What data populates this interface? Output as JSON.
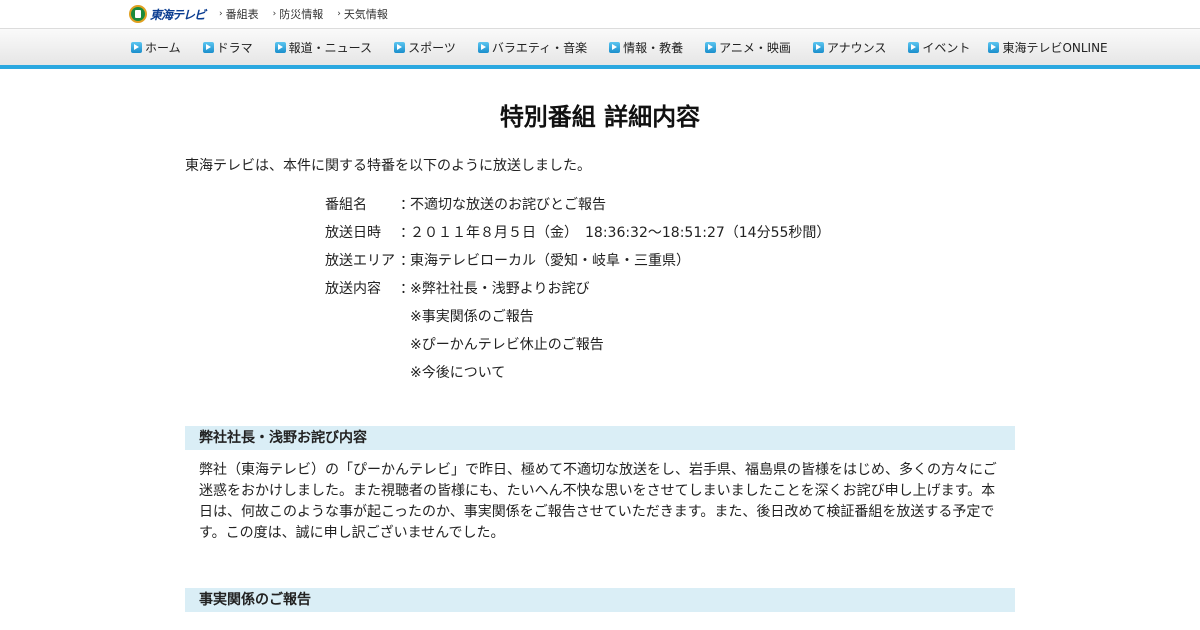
{
  "header": {
    "logo_text": "東海テレビ",
    "util_links": [
      "番組表",
      "防災情報",
      "天気情報"
    ]
  },
  "nav": {
    "items": [
      "ホーム",
      "ドラマ",
      "報道・ニュース",
      "スポーツ",
      "バラエティ・音楽",
      "情報・教養",
      "アニメ・映画",
      "アナウンス",
      "イベント",
      "東海テレビONLINE"
    ]
  },
  "main": {
    "title": "特別番組 詳細内容",
    "intro": "東海テレビは、本件に関する特番を以下のように放送しました。",
    "details": [
      {
        "label": "番組名",
        "sep": "：",
        "value": "不適切な放送のお詫びとご報告"
      },
      {
        "label": "放送日時",
        "sep": "：",
        "value": "２０１１年８月５日（金）　18:36:32～18:51:27（14分55秒間）"
      },
      {
        "label": "放送エリア",
        "sep": "：",
        "value": "東海テレビローカル（愛知・岐阜・三重県）"
      },
      {
        "label": "放送内容",
        "sep": "：",
        "value": "※弊社社長・浅野よりお詫び"
      }
    ],
    "content_items": [
      "※事実関係のご報告",
      "※ぴーかんテレビ休止のご報告",
      "※今後について"
    ],
    "sections": [
      {
        "heading": "弊社社長・浅野お詫び内容",
        "body": "弊社（東海テレビ）の「ぴーかんテレビ」で昨日、極めて不適切な放送をし、岩手県、福島県の皆様をはじめ、多くの方々にご迷惑をおかけしました。また視聴者の皆様にも、たいへん不快な思いをさせてしまいましたことを深くお詫び申し上げます。本日は、何故このような事が起こったのか、事実関係をご報告させていただきます。また、後日改めて検証番組を放送する予定です。この度は、誠に申し訳ございませんでした。"
      },
      {
        "heading": "事実関係のご報告",
        "body": ""
      }
    ]
  },
  "colors": {
    "nav_accent": "#2aa8e0",
    "section_bg": "#daeef6"
  }
}
